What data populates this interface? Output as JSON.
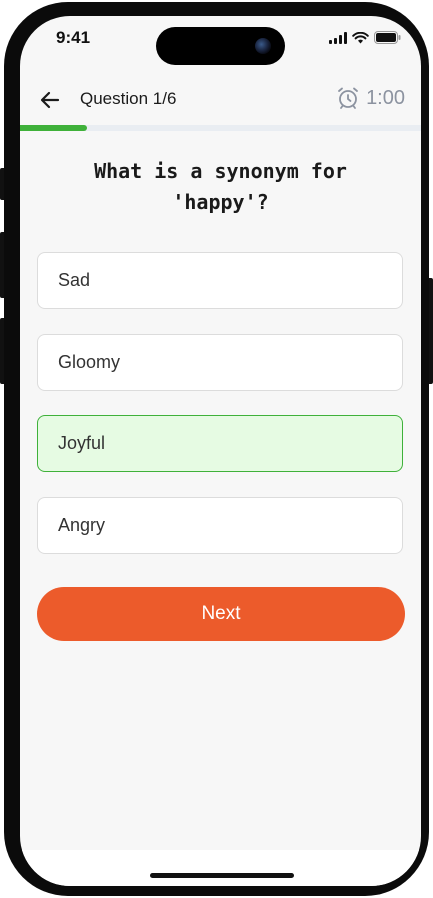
{
  "status_bar": {
    "time": "9:41"
  },
  "header": {
    "back_icon": "arrow-left-icon",
    "title": "Question 1/6",
    "timer_icon": "alarm-clock-icon",
    "timer_value": "1:00"
  },
  "progress": {
    "fraction": 0.167,
    "fill_color": "#3fb13a"
  },
  "question": {
    "text": "What is a synonym for 'happy'?"
  },
  "options": [
    {
      "label": "Sad",
      "selected": false
    },
    {
      "label": "Gloomy",
      "selected": false
    },
    {
      "label": "Joyful",
      "selected": true
    },
    {
      "label": "Angry",
      "selected": false
    }
  ],
  "next_button": {
    "label": "Next",
    "color": "#ec5b2b"
  }
}
